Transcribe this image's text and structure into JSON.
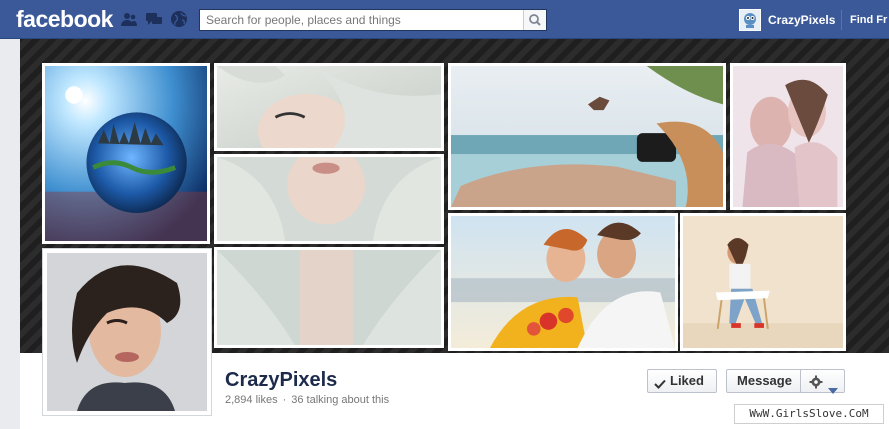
{
  "topbar": {
    "logo_text": "facebook",
    "search_placeholder": "Search for people, places and things",
    "profile_name": "CrazyPixels",
    "find_link": "Find Fr"
  },
  "page": {
    "name": "CrazyPixels",
    "likes": "2,894 likes",
    "talking": "36 talking about this",
    "separator": "·"
  },
  "actions": {
    "liked_label": "Liked",
    "message_label": "Message"
  },
  "icons": [
    "friend-requests-icon",
    "messages-icon",
    "notifications-globe-icon",
    "search-icon",
    "checkmark-icon",
    "gear-icon",
    "caret-down-icon"
  ],
  "cover_tiles": [
    "planet-city-photo",
    "woman-white-hair-eyes-photo",
    "woman-white-hair-lips-photo",
    "woman-white-hair-neck-photo",
    "photographer-pool-jump-photo",
    "two-women-embrace-photo",
    "couple-flowers-photo",
    "woman-sitting-chair-photo"
  ],
  "watermark": "WwW.GirlsSlove.CoM",
  "colors": {
    "brand_blue": "#3b5998",
    "page_name": "#1c2b4c",
    "cover_dark": "#2a2a2a"
  }
}
